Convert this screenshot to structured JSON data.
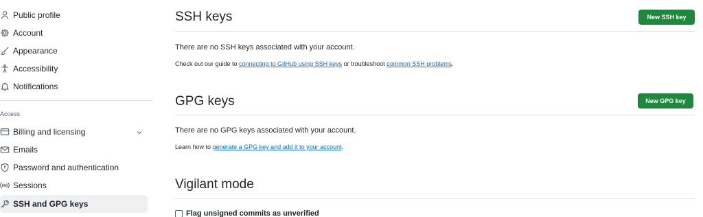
{
  "sidebar": {
    "items_top": [
      {
        "label": "Public profile",
        "icon": "person-icon"
      },
      {
        "label": "Account",
        "icon": "gear-icon"
      },
      {
        "label": "Appearance",
        "icon": "paintbrush-icon"
      },
      {
        "label": "Accessibility",
        "icon": "accessibility-icon"
      },
      {
        "label": "Notifications",
        "icon": "bell-icon"
      }
    ],
    "access_heading": "Access",
    "items_access": [
      {
        "label": "Billing and licensing",
        "icon": "credit-card-icon"
      },
      {
        "label": "Emails",
        "icon": "mail-icon"
      },
      {
        "label": "Password and authentication",
        "icon": "shield-lock-icon"
      },
      {
        "label": "Sessions",
        "icon": "broadcast-icon"
      },
      {
        "label": "SSH and GPG keys",
        "icon": "key-icon"
      }
    ]
  },
  "ssh": {
    "title": "SSH keys",
    "button": "New SSH key",
    "empty": "There are no SSH keys associated with your account.",
    "guide_prefix": "Check out our guide to ",
    "guide_link": "connecting to GitHub using SSH keys",
    "guide_middle": " or troubleshoot ",
    "guide_link2": "common SSH problems",
    "guide_suffix": "."
  },
  "gpg": {
    "title": "GPG keys",
    "button": "New GPG key",
    "empty": "There are no GPG keys associated with your account.",
    "learn_prefix": "Learn how to ",
    "learn_link": "generate a GPG key and add it to your account",
    "learn_suffix": "."
  },
  "vigilant": {
    "title": "Vigilant mode",
    "checkbox_label": "Flag unsigned commits as unverified"
  },
  "colors": {
    "primary_button": "#1f883d",
    "link": "#0969da",
    "active_bg": "#eef0f2"
  }
}
